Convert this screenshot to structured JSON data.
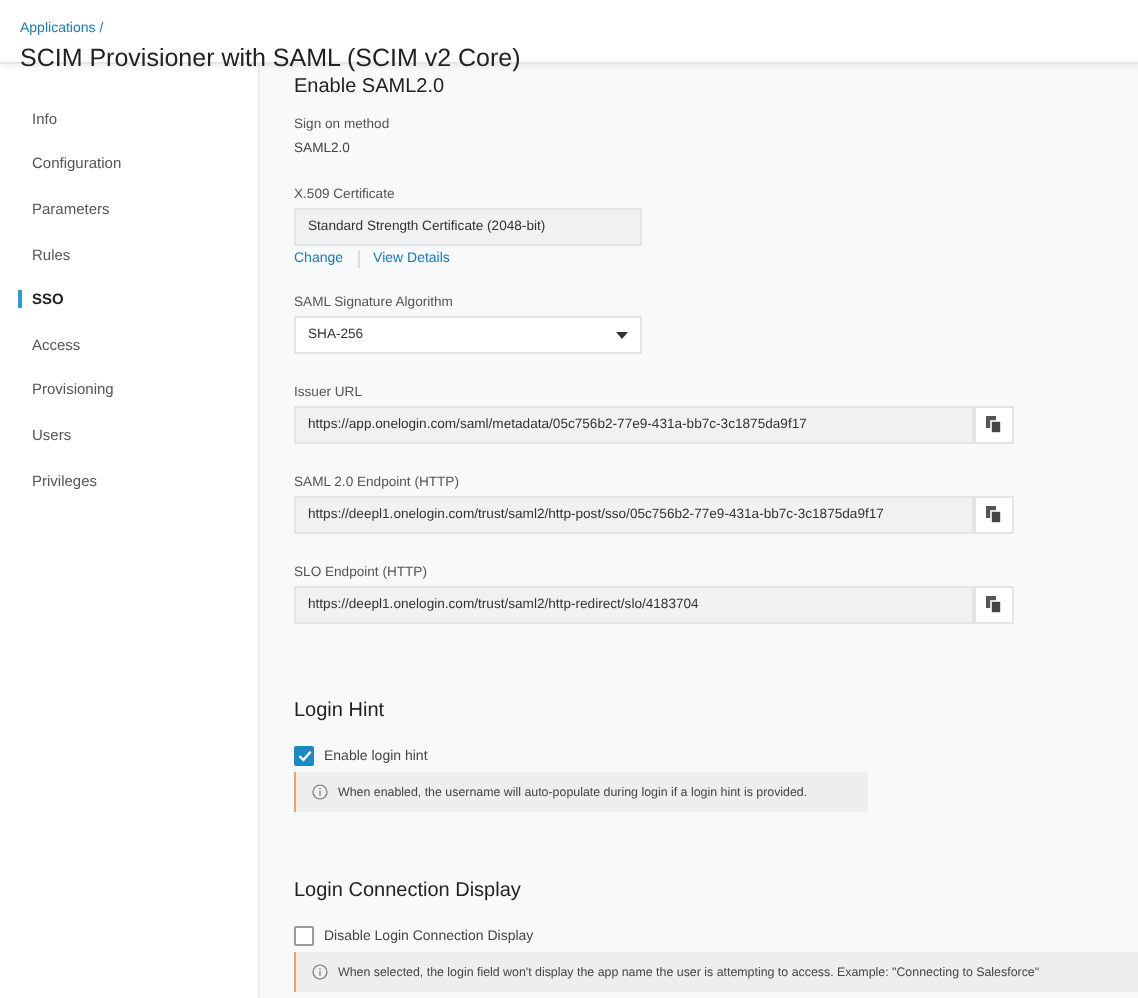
{
  "breadcrumb": "Applications /",
  "title": "SCIM Provisioner with SAML (SCIM v2 Core)",
  "sidebar": {
    "items": [
      {
        "label": "Info",
        "selected": false
      },
      {
        "label": "Configuration",
        "selected": false
      },
      {
        "label": "Parameters",
        "selected": false
      },
      {
        "label": "Rules",
        "selected": false
      },
      {
        "label": "SSO",
        "selected": true
      },
      {
        "label": "Access",
        "selected": false
      },
      {
        "label": "Provisioning",
        "selected": false
      },
      {
        "label": "Users",
        "selected": false
      },
      {
        "label": "Privileges",
        "selected": false
      }
    ]
  },
  "saml": {
    "heading": "Enable SAML2.0",
    "sign_on_label": "Sign on method",
    "sign_on_value": "SAML2.0",
    "cert_label": "X.509 Certificate",
    "cert_value": "Standard Strength Certificate (2048-bit)",
    "cert_links": [
      "Change",
      "View Details"
    ],
    "algo_label": "SAML Signature Algorithm",
    "algo_value": "SHA-256",
    "urls": [
      {
        "label": "Issuer URL",
        "value": "https://app.onelogin.com/saml/metadata/05c756b2-77e9-431a-bb7c-3c1875da9f17"
      },
      {
        "label": "SAML 2.0 Endpoint (HTTP)",
        "value": "https://deepl1.onelogin.com/trust/saml2/http-post/sso/05c756b2-77e9-431a-bb7c-3c1875da9f17"
      },
      {
        "label": "SLO Endpoint (HTTP)",
        "value": "https://deepl1.onelogin.com/trust/saml2/http-redirect/slo/4183704"
      }
    ]
  },
  "sections": [
    {
      "heading": "Login Hint",
      "checkbox": "Enable login hint",
      "checked": true,
      "info": "When enabled, the username will auto-populate during login if a login hint is provided."
    },
    {
      "heading": "Login Connection Display",
      "checkbox": "Disable Login Connection Display",
      "checked": false,
      "info": "When selected, the login field won't display the app name the user is attempting to access. Example: \"Connecting to Salesforce\""
    }
  ]
}
